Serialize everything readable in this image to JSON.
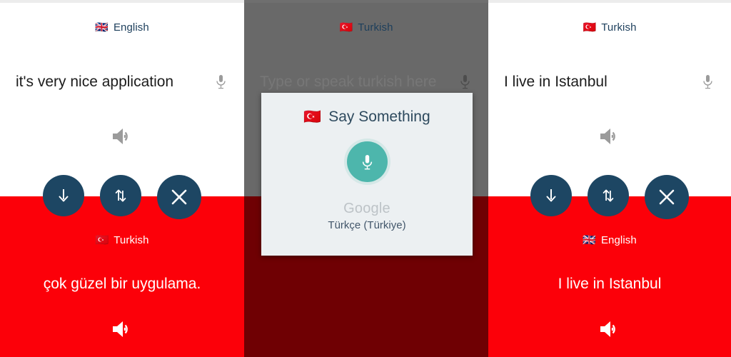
{
  "colors": {
    "red": "#fc0009",
    "navy": "#1d4663",
    "label_blue": "#1d3f5c",
    "teal": "#4db6ac",
    "dialog_bg": "#ecf0f2",
    "dim_gray": "#696969",
    "dim_red": "#6f0003"
  },
  "panels": [
    {
      "id": "panel-translated",
      "source_lang": {
        "label": "English",
        "flag": "🇬🇧"
      },
      "source_text": "it's very nice application",
      "source_is_placeholder": false,
      "mic_icon": "microphone-icon",
      "speaker_icon": "speaker-icon",
      "buttons": [
        {
          "name": "download-button",
          "icon": "arrow-down-icon"
        },
        {
          "name": "swap-languages-button",
          "icon": "swap-vertical-icon"
        },
        {
          "name": "clear-button",
          "icon": "close-icon"
        }
      ],
      "target_lang": {
        "label": "Turkish",
        "flag": "🇹🇷"
      },
      "target_text": "çok güzel bir uygulama."
    },
    {
      "id": "panel-listening",
      "source_lang": {
        "label": "Turkish",
        "flag": "🇹🇷"
      },
      "source_text": "Type or speak turkish here",
      "source_is_placeholder": true,
      "mic_icon": "microphone-icon",
      "dialog": {
        "title": "Say Something",
        "flag": "🇹🇷",
        "mic_icon": "microphone-icon",
        "brand": "Google",
        "locale": "Türkçe (Türkiye)"
      }
    },
    {
      "id": "panel-result",
      "source_lang": {
        "label": "Turkish",
        "flag": "🇹🇷"
      },
      "source_text": "I live in Istanbul",
      "source_is_placeholder": false,
      "mic_icon": "microphone-icon",
      "speaker_icon": "speaker-icon",
      "buttons": [
        {
          "name": "download-button",
          "icon": "arrow-down-icon"
        },
        {
          "name": "swap-languages-button",
          "icon": "swap-vertical-icon"
        },
        {
          "name": "clear-button",
          "icon": "close-icon"
        }
      ],
      "target_lang": {
        "label": "English",
        "flag": "🇬🇧"
      },
      "target_text": "I live in Istanbul"
    }
  ]
}
